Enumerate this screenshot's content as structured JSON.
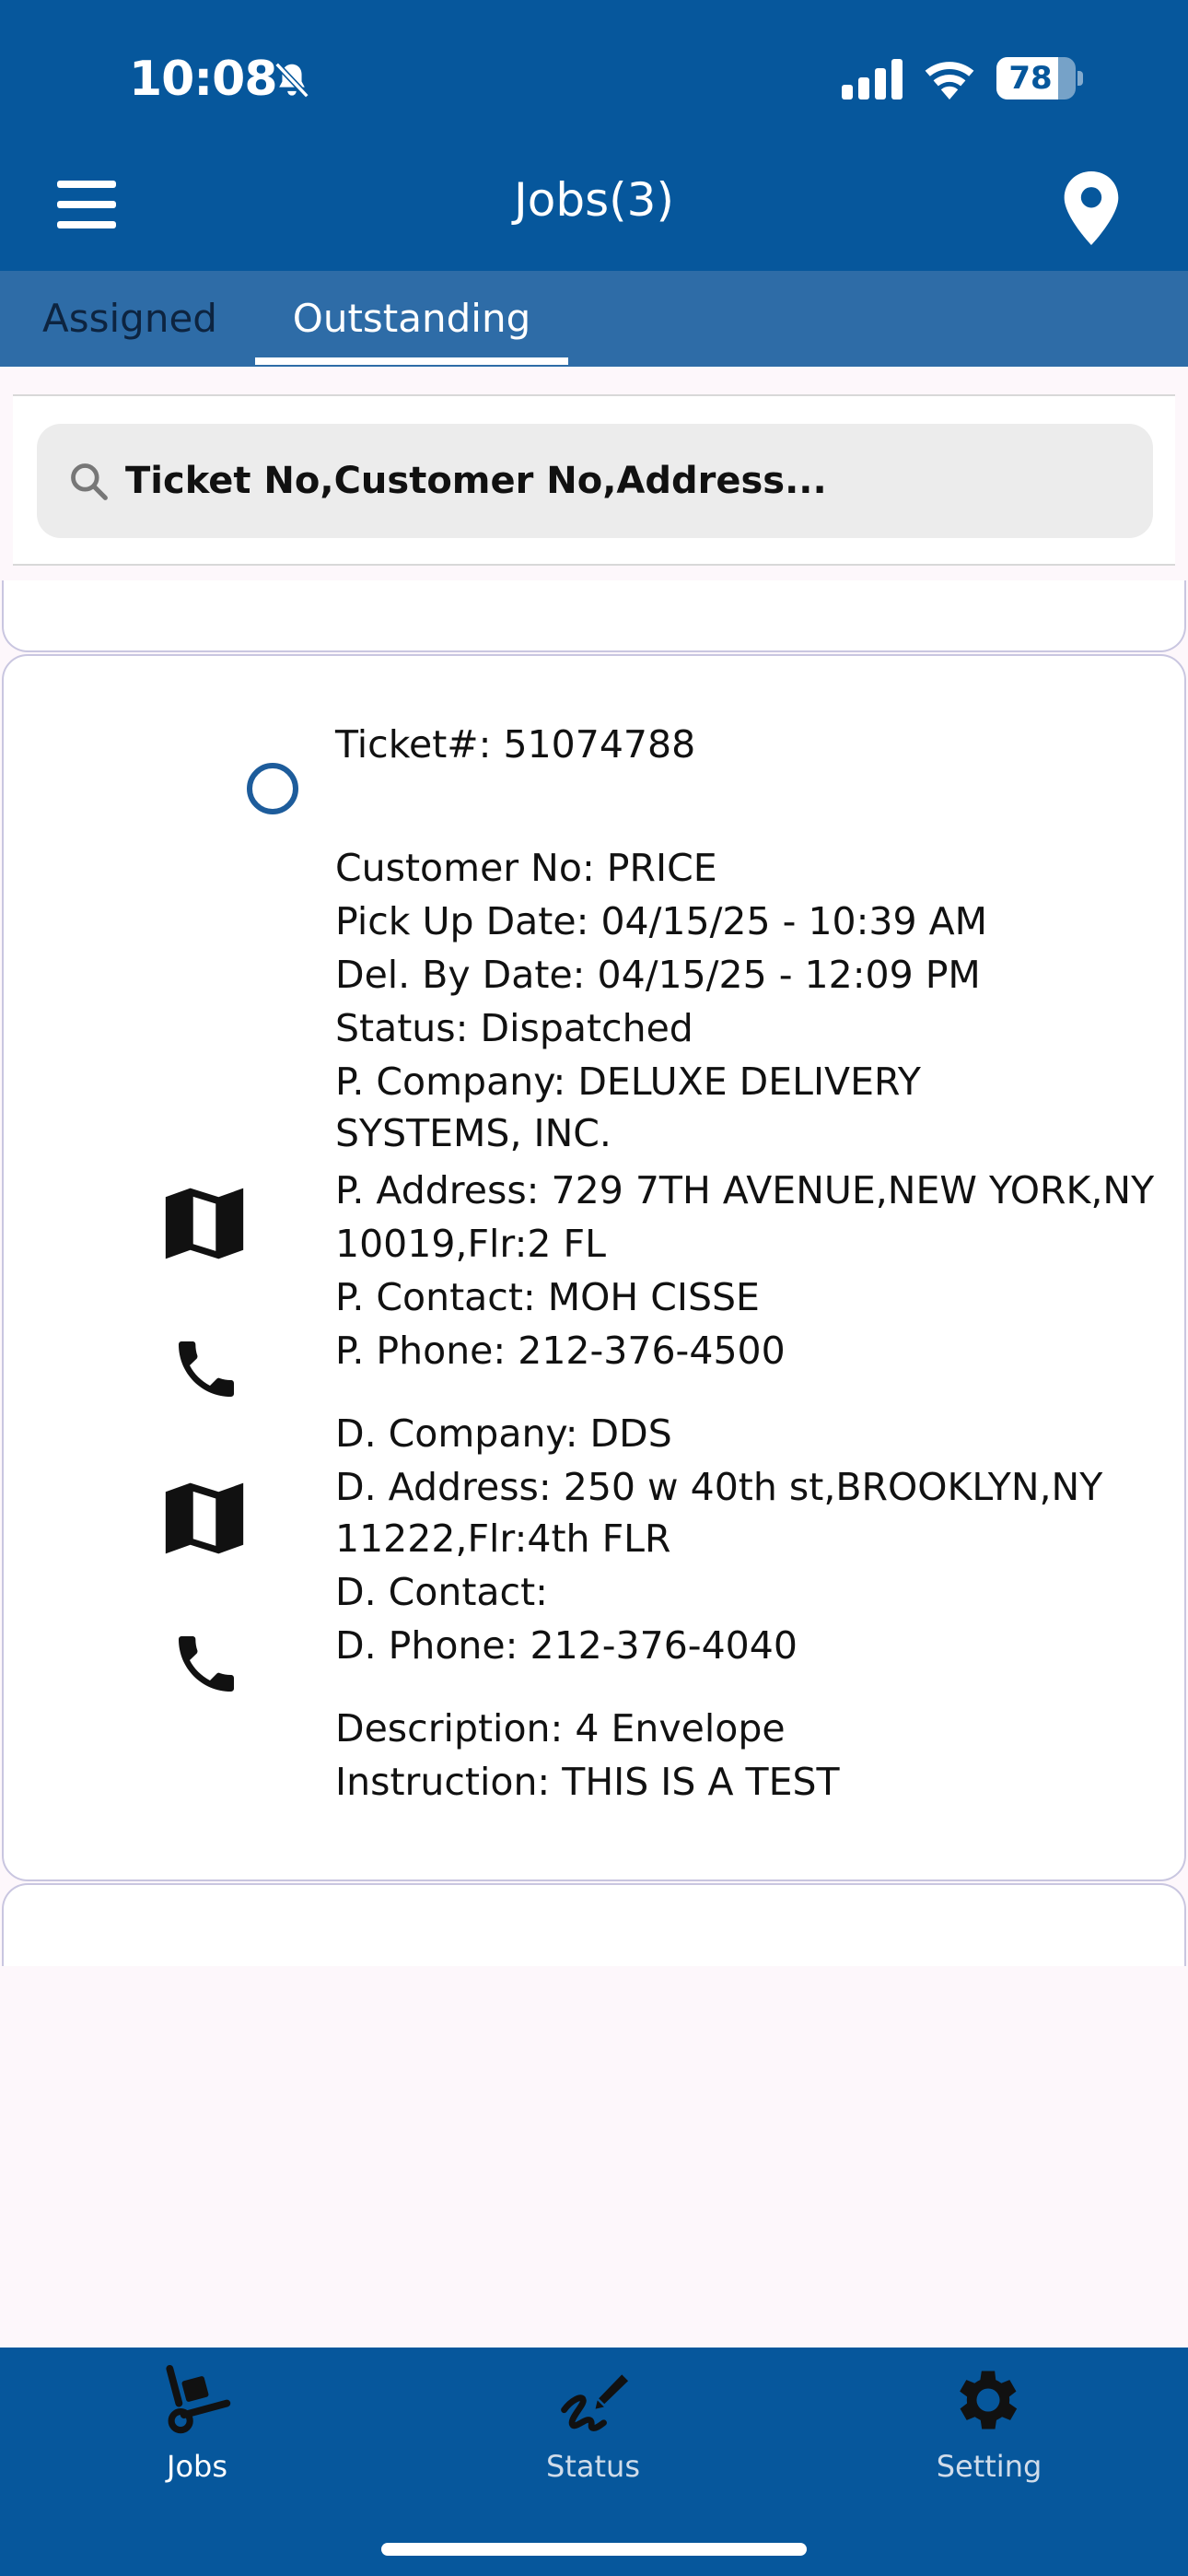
{
  "status_bar": {
    "time": "10:08",
    "battery": "78",
    "battery_level": 0.78
  },
  "header": {
    "title": "Jobs(3)"
  },
  "tabs": [
    {
      "label": "Assigned",
      "active": false
    },
    {
      "label": "Outstanding",
      "active": true
    }
  ],
  "search": {
    "placeholder": "Ticket No,Customer No,Address..."
  },
  "job": {
    "ticket": "Ticket#: 51074788",
    "customer_no": "Customer No: PRICE",
    "pickup_date": "Pick Up Date: 04/15/25 - 10:39 AM",
    "del_by_date": "Del. By Date: 04/15/25 - 12:09 PM",
    "status": "Status: Dispatched",
    "p_company_1": "P. Company: DELUXE DELIVERY",
    "p_company_2": "SYSTEMS, INC.",
    "p_address_1": "P. Address: 729 7TH AVENUE,NEW YORK,NY",
    "p_address_2": "10019,Flr:2 FL",
    "p_contact": "P. Contact: MOH CISSE",
    "p_phone": "P. Phone: 212-376-4500",
    "d_company": "D. Company: DDS",
    "d_address_1": "D. Address: 250 w 40th st,BROOKLYN,NY",
    "d_address_2": "11222,Flr:4th FLR",
    "d_contact": "D. Contact:",
    "d_phone": "D. Phone: 212-376-4040",
    "description": "Description: 4 Envelope",
    "instruction": "Instruction: THIS IS A TEST"
  },
  "bottom_nav": [
    {
      "label": "Jobs",
      "icon": "hand-truck-icon",
      "active": true
    },
    {
      "label": "Status",
      "icon": "signature-icon",
      "active": false
    },
    {
      "label": "Setting",
      "icon": "gear-icon",
      "active": false
    }
  ],
  "colors": {
    "primary": "#06579c",
    "tab_bar": "#2e6ca7",
    "active_nav": "#ffffff",
    "inactive_nav": "#d0dcea"
  }
}
